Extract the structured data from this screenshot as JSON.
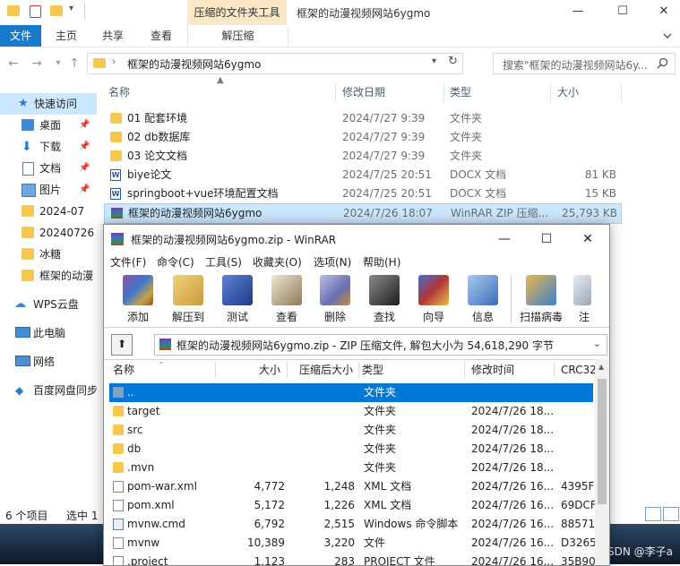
{
  "explorer": {
    "contextual_tab": "压缩的文件夹工具",
    "window_title": "框架的动漫视频网站6ygmo",
    "window_controls": {
      "minimize": "—",
      "maximize": "☐",
      "close": "✕"
    },
    "ribbon_tabs": [
      "文件",
      "主页",
      "共享",
      "查看",
      "解压缩"
    ],
    "address_path": "框架的动漫视频网站6ygmo",
    "search_placeholder": "搜索\"框架的动漫视频网站6y...",
    "nav_items": [
      {
        "label": "快速访问",
        "icon": "star-icon"
      },
      {
        "label": "桌面",
        "icon": "desktop-icon"
      },
      {
        "label": "下载",
        "icon": "download-icon"
      },
      {
        "label": "文档",
        "icon": "document-icon"
      },
      {
        "label": "图片",
        "icon": "picture-icon"
      },
      {
        "label": "2024-07",
        "icon": "folder-icon"
      },
      {
        "label": "20240726",
        "icon": "folder-icon"
      },
      {
        "label": "冰糖",
        "icon": "folder-icon"
      },
      {
        "label": "框架的动漫",
        "icon": "folder-icon"
      },
      {
        "label": "WPS云盘",
        "icon": "cloud-icon"
      },
      {
        "label": "此电脑",
        "icon": "computer-icon"
      },
      {
        "label": "网络",
        "icon": "network-icon"
      },
      {
        "label": "百度网盘同步",
        "icon": "baidu-cloud-icon"
      }
    ],
    "columns": {
      "name": "名称",
      "date": "修改日期",
      "type": "类型",
      "size": "大小"
    },
    "files": [
      {
        "name": "01 配套环境",
        "date": "2024/7/27 9:39",
        "type": "文件夹",
        "size": "",
        "icon": "folder-icon"
      },
      {
        "name": "02 db数据库",
        "date": "2024/7/27 9:39",
        "type": "文件夹",
        "size": "",
        "icon": "folder-icon"
      },
      {
        "name": "03 论文文档",
        "date": "2024/7/27 9:39",
        "type": "文件夹",
        "size": "",
        "icon": "folder-icon"
      },
      {
        "name": "biye论文",
        "date": "2024/7/25 20:51",
        "type": "DOCX 文档",
        "size": "81 KB",
        "icon": "word-doc-icon"
      },
      {
        "name": "springboot+vue环境配置文档",
        "date": "2024/7/25 20:51",
        "type": "DOCX 文档",
        "size": "15 KB",
        "icon": "word-doc-icon"
      },
      {
        "name": "框架的动漫视频网站6ygmo",
        "date": "2024/7/26 18:07",
        "type": "WinRAR ZIP 压缩...",
        "size": "25,793 KB",
        "icon": "winrar-archive-icon"
      }
    ],
    "status_count": "6 个项目",
    "status_selected": "选中 1",
    "watermark": "CSDN @李子a"
  },
  "winrar": {
    "title": "框架的动漫视频网站6ygmo.zip - WinRAR",
    "menu": [
      "文件(F)",
      "命令(C)",
      "工具(S)",
      "收藏夹(O)",
      "选项(N)",
      "帮助(H)"
    ],
    "toolbar": [
      {
        "label": "添加",
        "icon": "add-archive-icon",
        "color": "#8a5a2b"
      },
      {
        "label": "解压到",
        "icon": "extract-to-icon",
        "color": "#c89b3c"
      },
      {
        "label": "测试",
        "icon": "test-icon",
        "color": "#2a4d9b"
      },
      {
        "label": "查看",
        "icon": "view-glasses-icon",
        "color": "#8e7a5a"
      },
      {
        "label": "删除",
        "icon": "delete-icon",
        "color": "#6a6fb0"
      },
      {
        "label": "查找",
        "icon": "find-binoculars-icon",
        "color": "#3a3a3a"
      },
      {
        "label": "向导",
        "icon": "wizard-icon",
        "color": "#b2363a"
      },
      {
        "label": "信息",
        "icon": "info-icon",
        "color": "#3b6fb6"
      },
      {
        "label": "扫描病毒",
        "icon": "virus-scan-icon",
        "color": "#3f7fd0"
      },
      {
        "label": "注",
        "icon": "comment-icon",
        "color": "#9aa7b8"
      }
    ],
    "path": "框架的动漫视频网站6ygmo.zip - ZIP 压缩文件, 解包大小为 54,618,290 字节",
    "columns": {
      "name": "名称",
      "size": "大小",
      "packed": "压缩后大小",
      "type": "类型",
      "modified": "修改时间",
      "crc": "CRC32"
    },
    "rows": [
      {
        "name": "..",
        "size": "",
        "packed": "",
        "type": "文件夹",
        "modified": "",
        "crc": "",
        "icon": "parent-folder-icon"
      },
      {
        "name": "target",
        "size": "",
        "packed": "",
        "type": "文件夹",
        "modified": "2024/7/26 18...",
        "crc": "",
        "icon": "folder-icon"
      },
      {
        "name": "src",
        "size": "",
        "packed": "",
        "type": "文件夹",
        "modified": "2024/7/26 18...",
        "crc": "",
        "icon": "folder-icon"
      },
      {
        "name": "db",
        "size": "",
        "packed": "",
        "type": "文件夹",
        "modified": "2024/7/26 18...",
        "crc": "",
        "icon": "folder-icon"
      },
      {
        "name": ".mvn",
        "size": "",
        "packed": "",
        "type": "文件夹",
        "modified": "2024/7/26 18...",
        "crc": "",
        "icon": "folder-icon"
      },
      {
        "name": "pom-war.xml",
        "size": "4,772",
        "packed": "1,248",
        "type": "XML 文档",
        "modified": "2024/7/26 16...",
        "crc": "4395F",
        "icon": "xml-file-icon"
      },
      {
        "name": "pom.xml",
        "size": "5,172",
        "packed": "1,226",
        "type": "XML 文档",
        "modified": "2024/7/26 16...",
        "crc": "69DCF",
        "icon": "xml-file-icon"
      },
      {
        "name": "mvnw.cmd",
        "size": "6,792",
        "packed": "2,515",
        "type": "Windows 命令脚本",
        "modified": "2024/7/26 16...",
        "crc": "88571",
        "icon": "cmd-file-icon"
      },
      {
        "name": "mvnw",
        "size": "10,389",
        "packed": "3,220",
        "type": "文件",
        "modified": "2024/7/26 16...",
        "crc": "D3265",
        "icon": "file-icon"
      },
      {
        "name": ".project",
        "size": "1,123",
        "packed": "283",
        "type": "PROJECT 文件",
        "modified": "2024/7/26 16...",
        "crc": "35B90",
        "icon": "file-icon"
      }
    ]
  },
  "colors": {
    "accent": "#1979ca",
    "selection": "#cce8ff",
    "rar_selection": "#0078d7",
    "folder": "#f5c84b",
    "context_tab": "#fbe7c6"
  }
}
